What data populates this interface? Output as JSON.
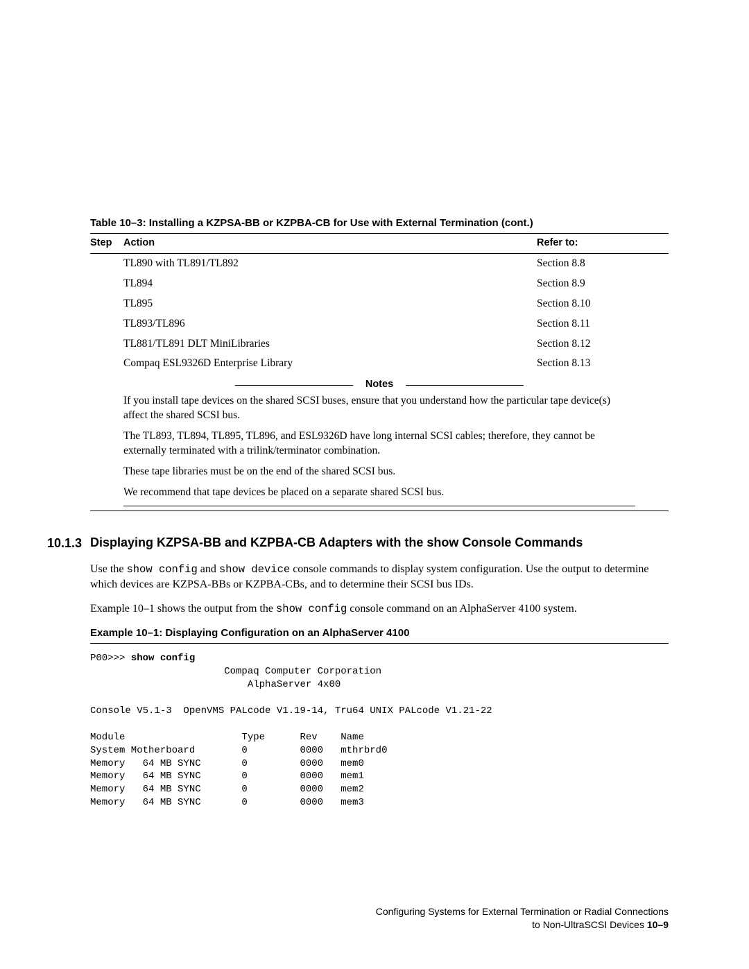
{
  "table": {
    "caption": "Table 10–3: Installing a KZPSA-BB or KZPBA-CB for Use with External Termination (cont.)",
    "headers": {
      "step": "Step",
      "action": "Action",
      "refer": "Refer to:"
    },
    "rows": [
      {
        "action": "TL890 with TL891/TL892",
        "refer": "Section 8.8"
      },
      {
        "action": "TL894",
        "refer": "Section 8.9"
      },
      {
        "action": "TL895",
        "refer": "Section 8.10"
      },
      {
        "action": "TL893/TL896",
        "refer": "Section 8.11"
      },
      {
        "action": "TL881/TL891 DLT MiniLibraries",
        "refer": "Section 8.12"
      },
      {
        "action": "Compaq ESL9326D Enterprise Library",
        "refer": "Section 8.13"
      }
    ]
  },
  "notes": {
    "label": "Notes",
    "para": [
      "If you install tape devices on the shared SCSI buses, ensure that you understand how the particular tape device(s) affect the shared SCSI bus.",
      "The TL893, TL894, TL895, TL896, and ESL9326D have long internal SCSI cables; therefore, they cannot be externally terminated with a trilink/terminator combination.",
      "These tape libraries must be on the end of the shared SCSI bus.",
      "We recommend that tape devices be placed on a separate shared SCSI bus."
    ]
  },
  "section": {
    "number": "10.1.3",
    "title": "Displaying KZPSA-BB and KZPBA-CB Adapters with the show Console Commands",
    "p1_a": "Use the ",
    "p1_cmd1": "show config",
    "p1_b": " and ",
    "p1_cmd2": "show device",
    "p1_c": " console commands to display system configuration. Use the output to determine which devices are KZPSA-BBs or KZPBA-CBs, and to determine their SCSI bus IDs.",
    "p2_a": "Example 10–1 shows the output from the ",
    "p2_cmd": "show config",
    "p2_b": " console command on an AlphaServer 4100 system."
  },
  "example": {
    "caption": "Example 10–1: Displaying Configuration on an AlphaServer 4100",
    "prompt": "P00>>> ",
    "cmd": "show config",
    "output": "                       Compaq Computer Corporation\n                           AlphaServer 4x00\n\nConsole V5.1-3  OpenVMS PALcode V1.19-14, Tru64 UNIX PALcode V1.21-22\n\nModule                    Type      Rev    Name\nSystem Motherboard        0         0000   mthrbrd0\nMemory   64 MB SYNC       0         0000   mem0\nMemory   64 MB SYNC       0         0000   mem1\nMemory   64 MB SYNC       0         0000   mem2\nMemory   64 MB SYNC       0         0000   mem3"
  },
  "footer": {
    "line1": "Configuring Systems for External Termination or Radial Connections",
    "line2_a": "to Non-UltraSCSI Devices  ",
    "line2_b": "10–9"
  }
}
